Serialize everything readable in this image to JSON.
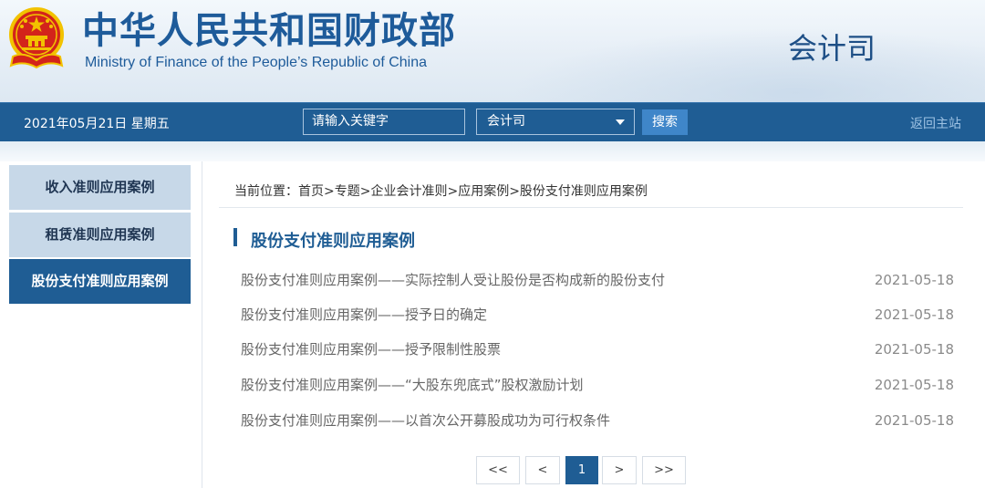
{
  "header": {
    "ministry_cn": "中华人民共和国财政部",
    "ministry_en": "Ministry of Finance of the People’s Republic of China",
    "department": "会计司",
    "emblem_icon": "national-emblem-icon"
  },
  "navbar": {
    "date": "2021年05月21日  星期五",
    "search_placeholder": "请输入关键字",
    "select_value": "会计司",
    "search_button": "搜索",
    "home_link": "返回主站"
  },
  "sidebar": {
    "items": [
      {
        "label": "收入准则应用案例",
        "active": false
      },
      {
        "label": "租赁准则应用案例",
        "active": false
      },
      {
        "label": "股份支付准则应用案例",
        "active": true
      }
    ]
  },
  "main": {
    "breadcrumb": "当前位置：首页>专题>企业会计准则>应用案例>股份支付准则应用案例",
    "section_title": "股份支付准则应用案例",
    "articles": [
      {
        "title": "股份支付准则应用案例——实际控制人受让股份是否构成新的股份支付",
        "date": "2021-05-18"
      },
      {
        "title": "股份支付准则应用案例——授予日的确定",
        "date": "2021-05-18"
      },
      {
        "title": "股份支付准则应用案例——授予限制性股票",
        "date": "2021-05-18"
      },
      {
        "title": "股份支付准则应用案例——“大股东兜底式”股权激励计划",
        "date": "2021-05-18"
      },
      {
        "title": "股份支付准则应用案例——以首次公开募股成功为可行权条件",
        "date": "2021-05-18"
      }
    ]
  },
  "pagination": {
    "first": "<<",
    "prev": "<",
    "current": "1",
    "next": ">",
    "last": ">>"
  },
  "colors": {
    "brand_blue": "#1f5d94",
    "title_blue": "#1e5b9a",
    "emblem_red": "#d3241b",
    "emblem_gold": "#f2c200"
  }
}
